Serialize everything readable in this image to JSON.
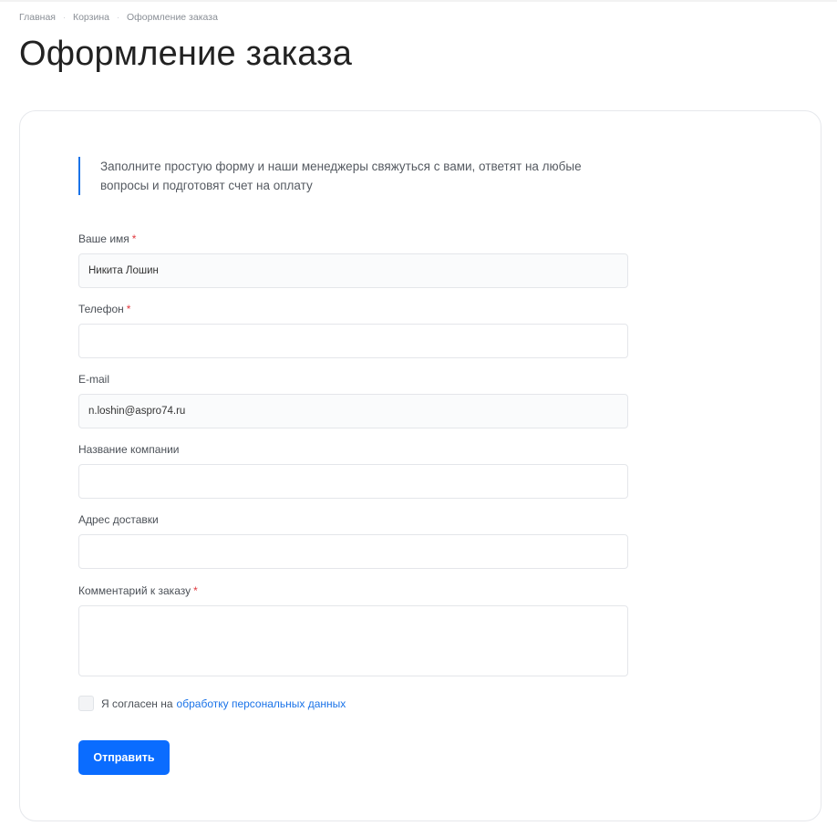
{
  "breadcrumb": {
    "items": [
      "Главная",
      "Корзина",
      "Оформление заказа"
    ],
    "separator": "·"
  },
  "page": {
    "title": "Оформление заказа"
  },
  "form": {
    "intro": "Заполните простую форму и наши менеджеры свяжуться с вами, ответят на любые вопросы и подготовят счет на оплату",
    "required_mark": "*",
    "fields": {
      "name": {
        "label": "Ваше имя",
        "value": "Никита Лошин",
        "required": true
      },
      "phone": {
        "label": "Телефон",
        "value": "",
        "required": true
      },
      "email": {
        "label": "E-mail",
        "value": "n.loshin@aspro74.ru",
        "required": false
      },
      "company": {
        "label": "Название компании",
        "value": "",
        "required": false
      },
      "address": {
        "label": "Адрес доставки",
        "value": "",
        "required": false
      },
      "comment": {
        "label": "Комментарий к заказу",
        "value": "",
        "required": true
      }
    },
    "consent": {
      "text": "Я согласен на",
      "link": "обработку персональных данных",
      "checked": false
    },
    "submit_label": "Отправить"
  },
  "colors": {
    "accent": "#0a6cff",
    "link": "#1a73e8",
    "required": "#e0383e",
    "border": "#e4e6ea"
  }
}
